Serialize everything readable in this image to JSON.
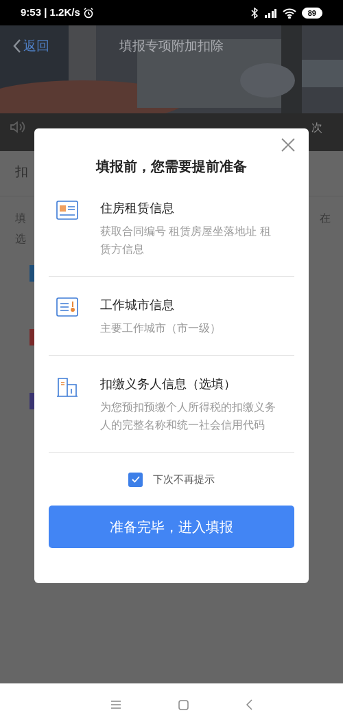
{
  "status_bar": {
    "time": "9:53 | 1.2K/s",
    "battery": "89"
  },
  "header": {
    "back_label": "返回",
    "title": "填报专项附加扣除"
  },
  "notice": {
    "visible_text": "次"
  },
  "page": {
    "section_title": "扣",
    "intro_left": [
      "填",
      "选"
    ],
    "intro_right": "在",
    "item_icons": [
      {
        "color": "#1f4f7a"
      },
      {
        "color": "#7a2a2a"
      },
      {
        "color": "#3a3470"
      }
    ]
  },
  "dialog": {
    "title": "填报前，您需要提前准备",
    "items": [
      {
        "kind": "rent",
        "title": "住房租赁信息",
        "description": "获取合同编号 租赁房屋坐落地址 租赁方信息"
      },
      {
        "kind": "city",
        "title": "工作城市信息",
        "description": "主要工作城市（市一级）"
      },
      {
        "kind": "building",
        "title": "扣缴义务人信息（选填）",
        "description": "为您预扣预缴个人所得税的扣缴义务人的完整名称和统一社会信用代码"
      }
    ],
    "dont_show_again": {
      "label": "下次不再提示",
      "checked": true
    },
    "confirm_button": "准备完毕，进入填报"
  }
}
